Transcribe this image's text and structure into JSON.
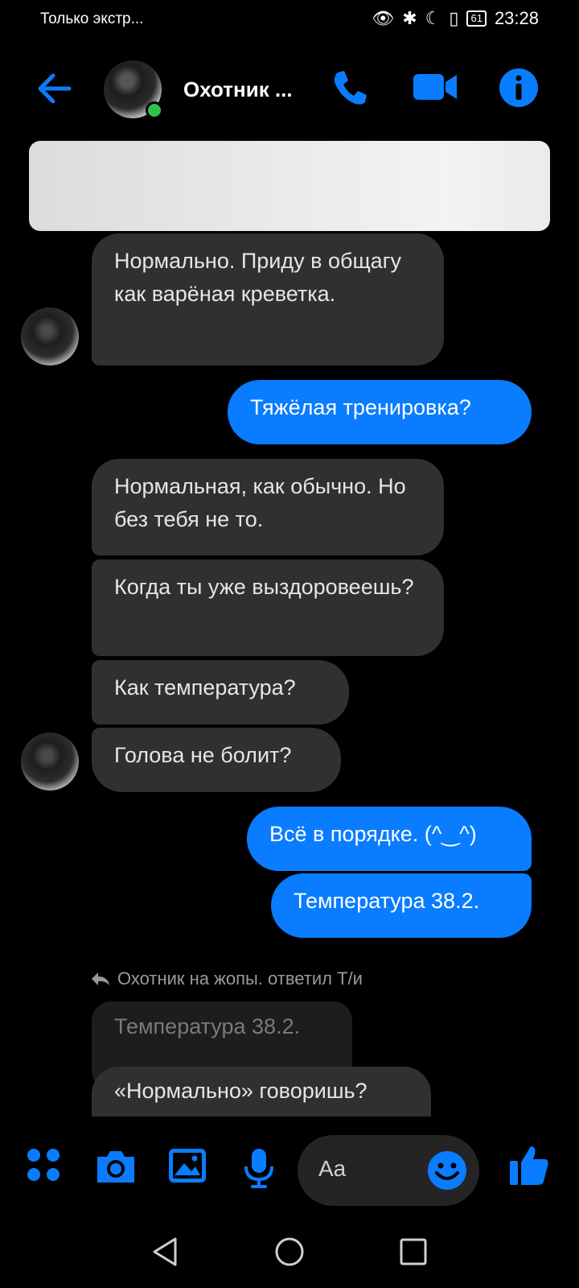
{
  "status_bar": {
    "carrier": "Только экстр...",
    "battery": "61",
    "time": "23:28"
  },
  "header": {
    "contact_name": "Охотник ...",
    "back_icon": "arrow-left-icon",
    "call_icon": "phone-icon",
    "video_icon": "video-camera-icon",
    "info_icon": "info-icon",
    "accent": "#0a7cff"
  },
  "messages": [
    {
      "side": "in",
      "text": "Нормально. Приду в общагу как варёная креветка."
    },
    {
      "side": "out",
      "text": "Тяжёлая тренировка?"
    },
    {
      "side": "in",
      "text": "Нормальная, как обычно. Но без тебя не то."
    },
    {
      "side": "in",
      "text": "Когда ты уже выздоровеешь?"
    },
    {
      "side": "in",
      "text": "Как температура?"
    },
    {
      "side": "in",
      "text": "Голова не болит?"
    },
    {
      "side": "out",
      "text": "Всё в порядке. (^‿^)"
    },
    {
      "side": "out",
      "text": "Температура 38.2."
    }
  ],
  "reply": {
    "label": "Охотник на жопы. ответил Т/и",
    "quoted": "Температура 38.2.",
    "text": "«Нормально» говоришь?"
  },
  "composer": {
    "placeholder": "Aa"
  }
}
